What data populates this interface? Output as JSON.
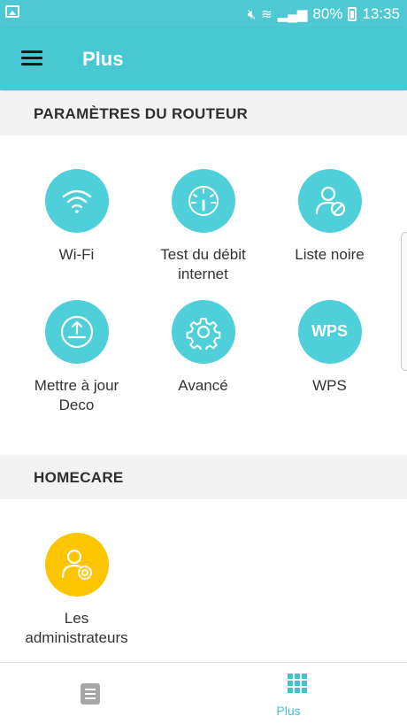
{
  "status_bar": {
    "battery": "80%",
    "time": "13:35"
  },
  "header": {
    "title": "Plus"
  },
  "sections": [
    {
      "title": "PARAMÈTRES DU ROUTEUR",
      "items": [
        {
          "label": "Wi-Fi",
          "icon": "wifi-icon"
        },
        {
          "label": "Test du débit\ninternet",
          "icon": "speedometer-icon"
        },
        {
          "label": "Liste noire",
          "icon": "user-blocked-icon"
        },
        {
          "label": "Mettre à jour\nDeco",
          "icon": "upload-icon"
        },
        {
          "label": "Avancé",
          "icon": "gear-icon"
        },
        {
          "label": "WPS",
          "icon": "wps-icon",
          "badge_text": "WPS"
        }
      ]
    },
    {
      "title": "HOMECARE",
      "items": [
        {
          "label": "Les\nadministrateurs",
          "icon": "admin-user-gear-icon"
        }
      ]
    }
  ],
  "bottom_nav": [
    {
      "label": "",
      "icon": "document-icon",
      "active": false
    },
    {
      "label": "Plus",
      "icon": "grid-icon",
      "active": true
    }
  ],
  "colors": {
    "accent": "#47c8d3",
    "icon_circle": "#4ecfd9",
    "homecare_circle": "#fdc400",
    "active_nav": "#3fc3cf"
  }
}
